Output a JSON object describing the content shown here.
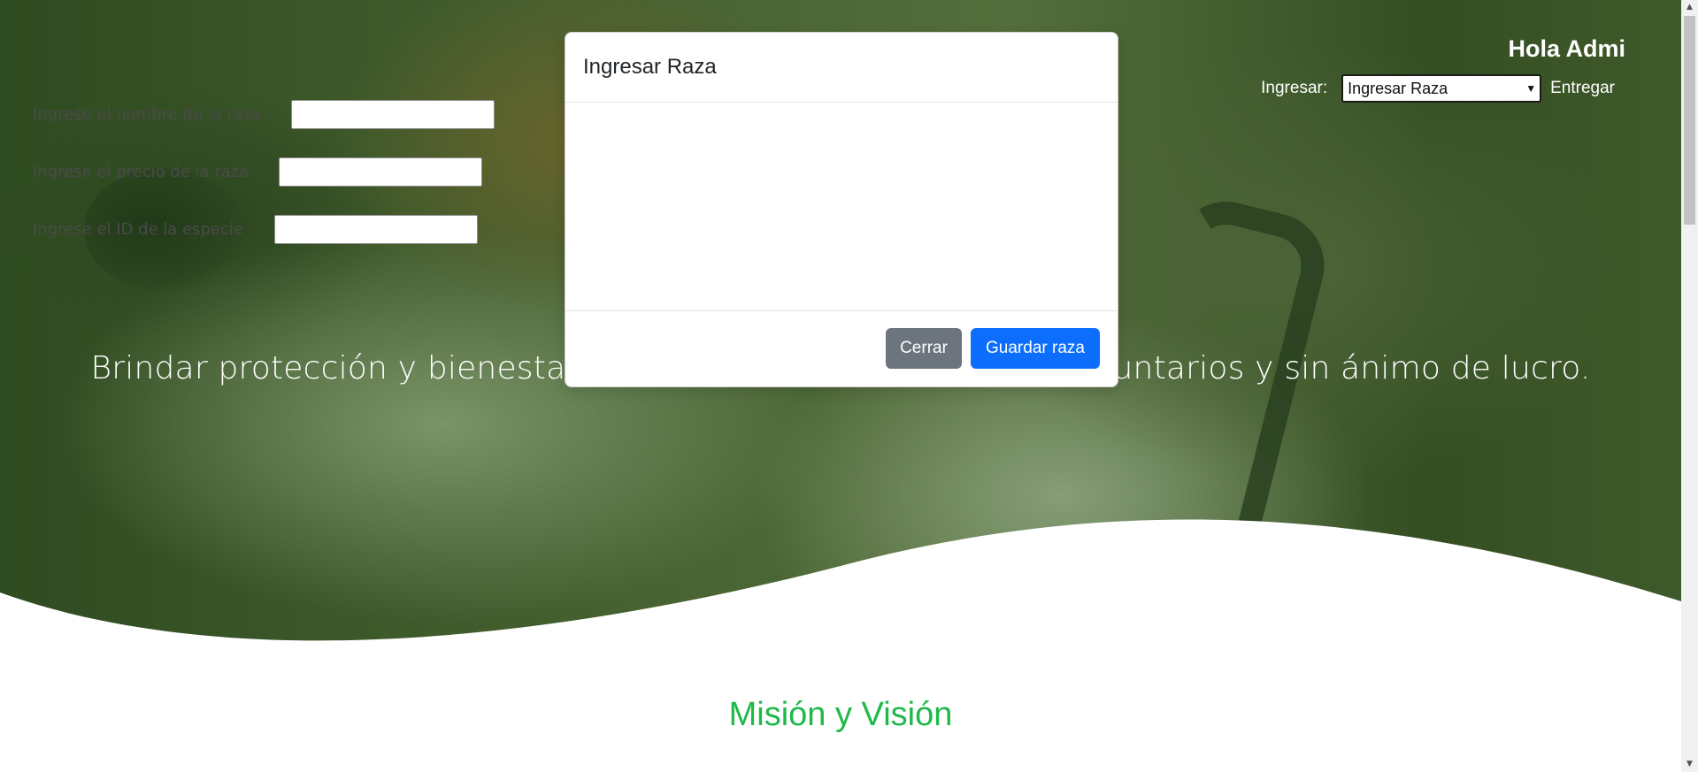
{
  "header": {
    "greeting": "Hola Admi",
    "ingresar_label": "Ingresar:",
    "ingresar_select_value": "Ingresar Raza",
    "entregar_link": "Entregar"
  },
  "hero": {
    "tagline": "Brindar protección y bienestar animal, mediante programas voluntarios y sin ánimo de lucro."
  },
  "section": {
    "title": "Misión y Visión"
  },
  "modal": {
    "title": "Ingresar Raza",
    "fields": [
      {
        "label": "Ingrese el nombre de la raza",
        "value": ""
      },
      {
        "label": "Ingrese el precio de la raza",
        "value": ""
      },
      {
        "label": "Ingrese el ID de la especie",
        "value": ""
      }
    ],
    "close_button": "Cerrar",
    "save_button": "Guardar raza"
  },
  "colors": {
    "primary": "#0d6efd",
    "secondary": "#6c757d",
    "accent_green": "#1fb94a"
  }
}
